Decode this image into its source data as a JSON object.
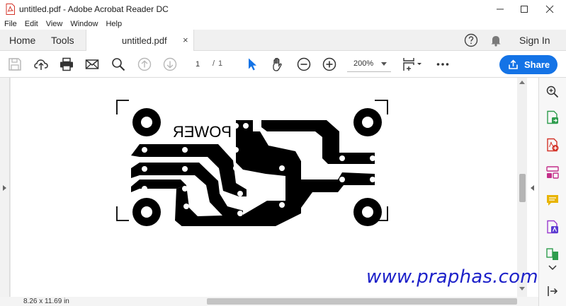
{
  "window": {
    "title": "untitled.pdf - Adobe Acrobat Reader DC"
  },
  "menu": [
    "File",
    "Edit",
    "View",
    "Window",
    "Help"
  ],
  "tabs": {
    "home": "Home",
    "tools": "Tools",
    "document": "untitled.pdf",
    "close_glyph": "×"
  },
  "header_actions": {
    "sign_in": "Sign In"
  },
  "toolbar": {
    "page_current": "1",
    "page_separator": "/",
    "page_total": "1",
    "zoom": "200%",
    "share_label": "Share"
  },
  "document": {
    "page_size": "8.26 x 11.69 in",
    "pcb_label": "POWER"
  },
  "watermark": "www.praphas.com",
  "colors": {
    "accent": "#1473e6",
    "watermark": "#1d21c9",
    "pcb": "#000000",
    "red_icon": "#d4352a",
    "green_icon": "#2f9d4e",
    "purple_icon": "#9b3ccf",
    "yellow_icon": "#e8b400"
  }
}
